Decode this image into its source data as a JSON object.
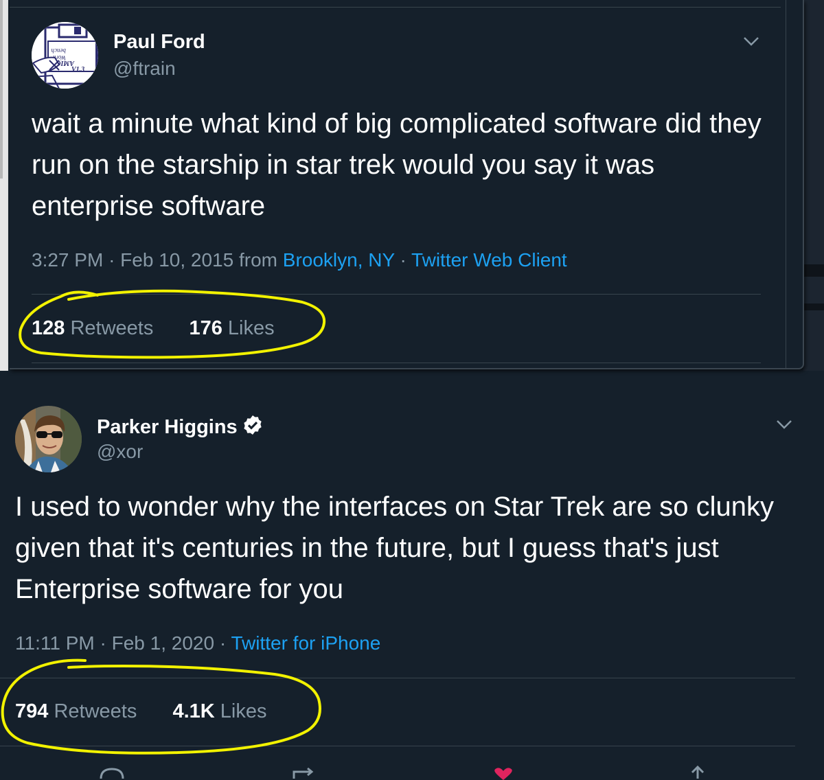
{
  "tweet1": {
    "name": "Paul Ford",
    "handle": "@ftrain",
    "avatar_disk_label": [
      "AMIGA",
      "Work",
      "bench",
      "V1.3"
    ],
    "text": "wait a minute what kind of big complicated software did they run on the starship in star trek would you say it was enterprise software",
    "time": "3:27 PM",
    "date": "Feb 10, 2015",
    "from_word": "from",
    "location": "Brooklyn, NY",
    "source": "Twitter Web Client",
    "retweets_count": "128",
    "retweets_label": "Retweets",
    "likes_count": "176",
    "likes_label": "Likes"
  },
  "tweet2": {
    "name": "Parker Higgins",
    "handle": "@xor",
    "text": "I used to wonder why the interfaces on Star Trek are so clunky given that it's centuries in the future, but I guess that's just Enterprise software for you",
    "time": "11:11 PM",
    "date": "Feb 1, 2020",
    "source": "Twitter for iPhone",
    "retweets_count": "794",
    "retweets_label": "Retweets",
    "likes_count": "4.1K",
    "likes_label": "Likes"
  },
  "separator": "·",
  "colors": {
    "background": "#15202b",
    "text": "#ffffff",
    "muted": "#8899a6",
    "link": "#1da1f2",
    "divider": "#38444d",
    "highlight": "#f2f200",
    "like": "#e0245e"
  }
}
